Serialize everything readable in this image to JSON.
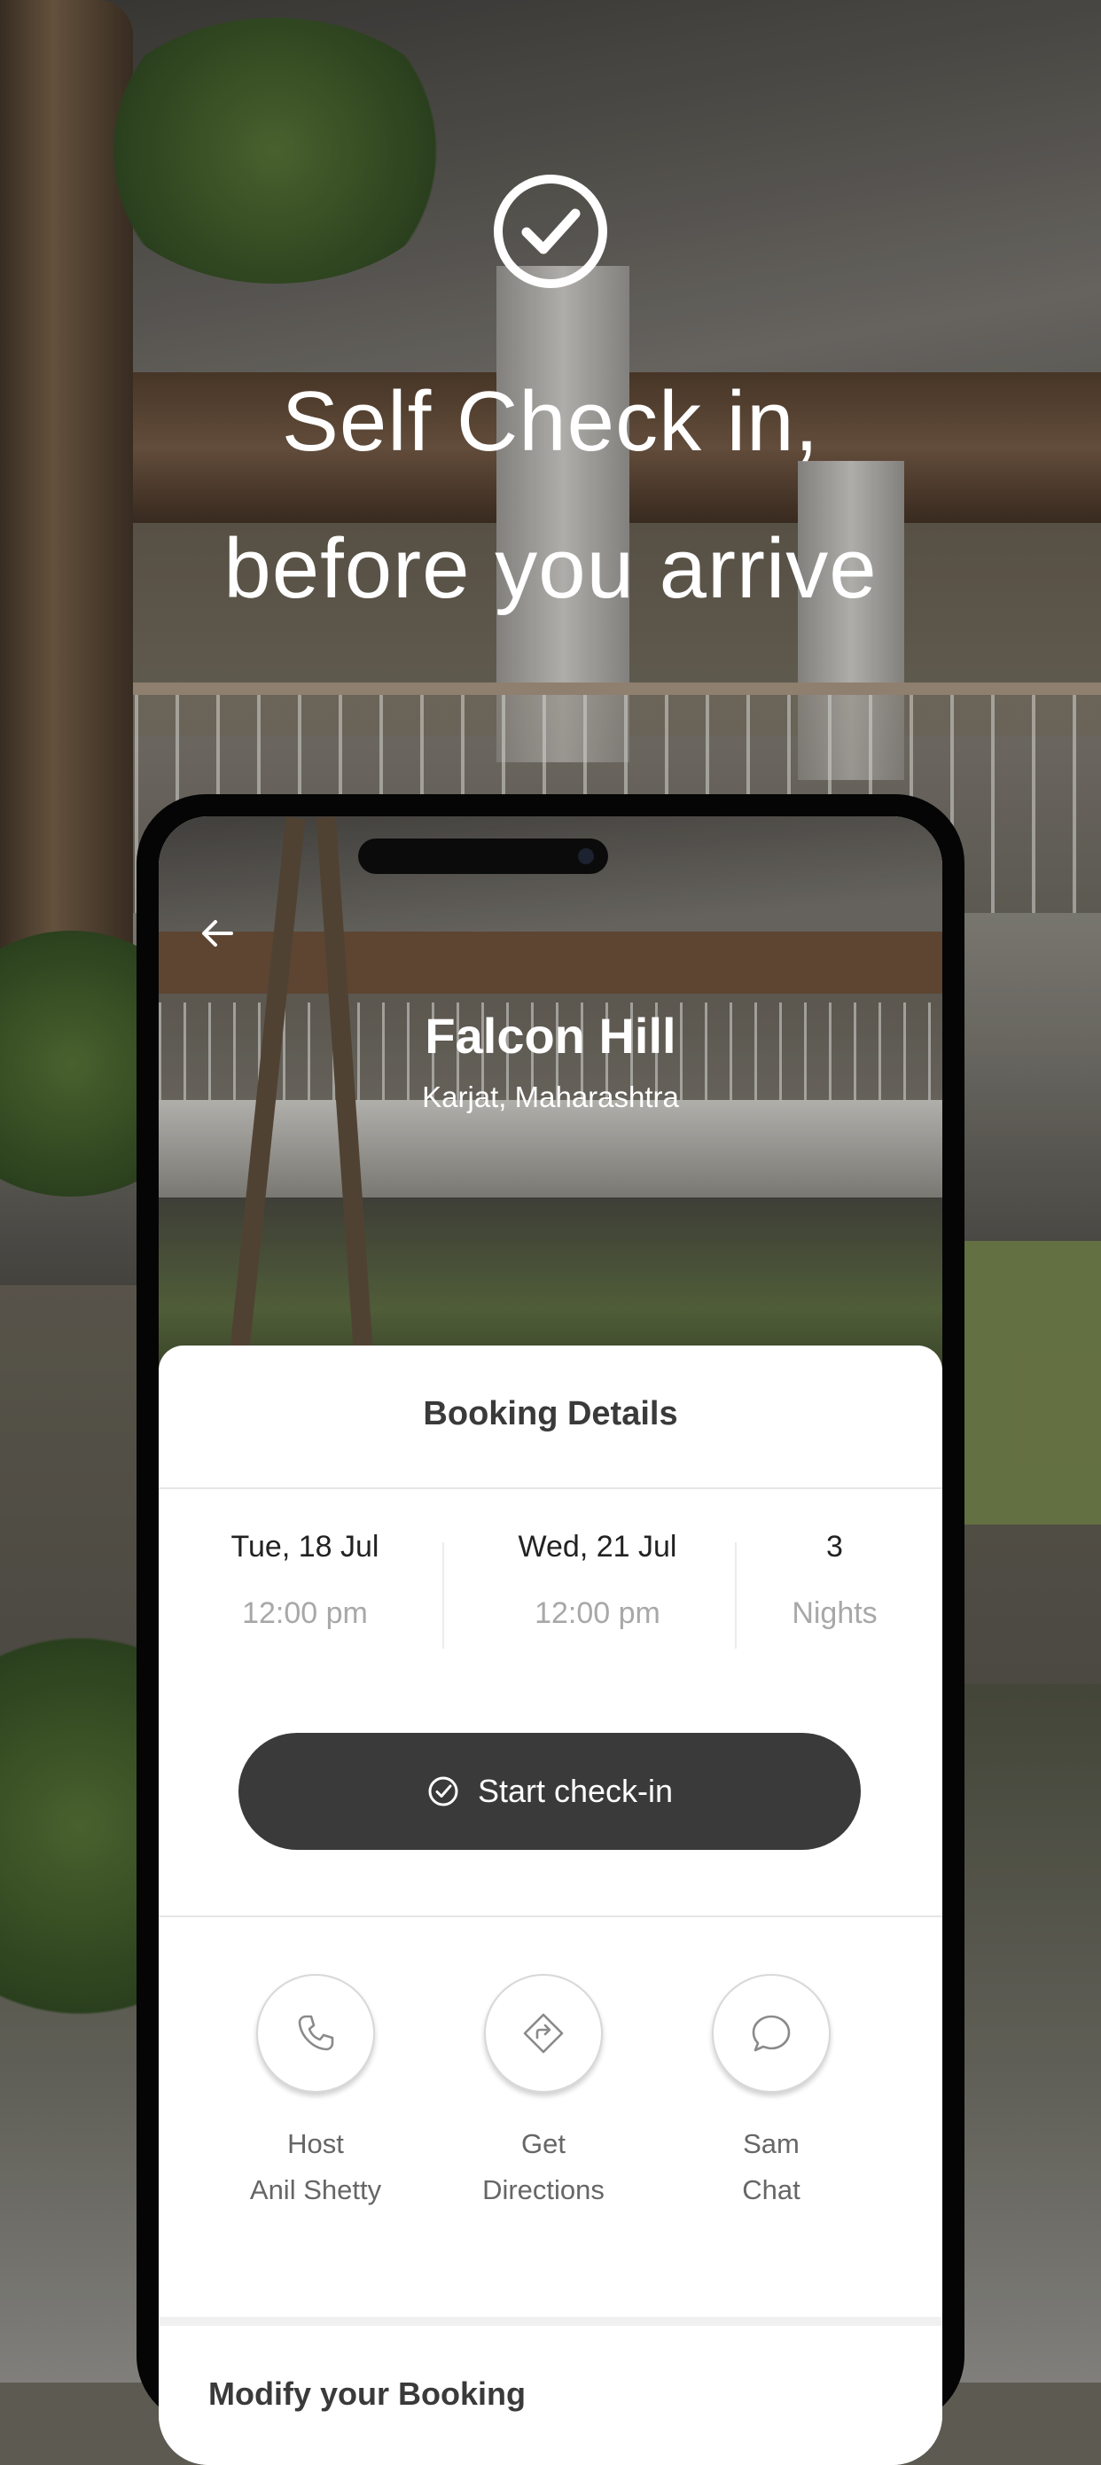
{
  "hero": {
    "title_line1": "Self Check in,",
    "title_line2": "before you arrive"
  },
  "hotel": {
    "name": "Falcon Hill",
    "location": "Karjat, Maharashtra"
  },
  "booking": {
    "title": "Booking Details",
    "checkin": {
      "date": "Tue, 18 Jul",
      "time": "12:00 pm"
    },
    "checkout": {
      "date": "Wed, 21 Jul",
      "time": "12:00 pm"
    },
    "nights": {
      "count": "3",
      "label": "Nights"
    },
    "cta_label": "Start check-in"
  },
  "actions": [
    {
      "line1": "Host",
      "line2": "Anil Shetty",
      "icon": "phone-icon"
    },
    {
      "line1": "Get",
      "line2": "Directions",
      "icon": "directions-icon"
    },
    {
      "line1": "Sam",
      "line2": "Chat",
      "icon": "chat-icon"
    }
  ],
  "modify": {
    "title": "Modify your Booking"
  },
  "colors": {
    "button_bg": "#3a3a3a",
    "text_dark": "#222222",
    "text_muted": "#a8a8a8"
  }
}
